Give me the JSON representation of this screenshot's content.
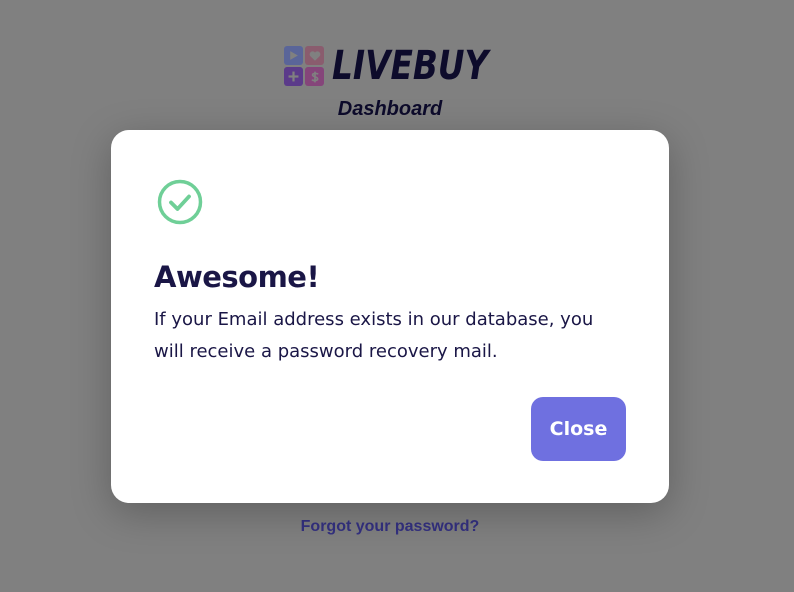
{
  "brand": {
    "name": "LIVEBUY",
    "subtitle": "Dashboard",
    "logo_tiles": [
      "play-icon",
      "heart-icon",
      "plus-icon",
      "dollar-icon"
    ]
  },
  "page": {
    "forgot_password_link": "Forgot your password?"
  },
  "modal": {
    "icon": "check-circle-icon",
    "title": "Awesome!",
    "message": "If your Email address exists in our database, you will receive a password recovery mail.",
    "close_label": "Close"
  },
  "colors": {
    "backdrop": "#808080",
    "accent_button": "#6f70e0",
    "success_green": "#6fcf97",
    "text_dark": "#1a1646",
    "link": "#343181"
  }
}
